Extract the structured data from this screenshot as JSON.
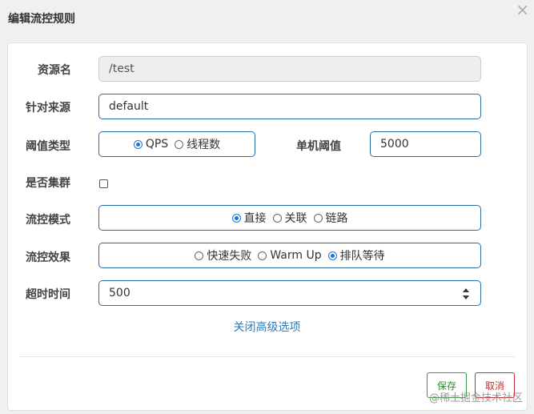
{
  "dialog": {
    "title": "编辑流控规则",
    "close_label": "×"
  },
  "form": {
    "resource": {
      "label": "资源名",
      "value": "/test"
    },
    "limit_app": {
      "label": "针对来源",
      "value": "default"
    },
    "threshold_type": {
      "label": "阈值类型",
      "options": [
        "QPS",
        "线程数"
      ],
      "selected": "QPS"
    },
    "single_threshold": {
      "label": "单机阈值",
      "value": "5000"
    },
    "cluster": {
      "label": "是否集群",
      "checked": false
    },
    "strategy": {
      "label": "流控模式",
      "options": [
        "直接",
        "关联",
        "链路"
      ],
      "selected": "直接"
    },
    "control_behavior": {
      "label": "流控效果",
      "options": [
        "快速失败",
        "Warm Up",
        "排队等待"
      ],
      "selected": "排队等待"
    },
    "timeout": {
      "label": "超时时间",
      "value": "500"
    }
  },
  "advanced_link": "关闭高级选项",
  "buttons": {
    "save": "保存",
    "cancel": "取消"
  },
  "watermark": "@稀土掘金技术社区",
  "colors": {
    "accent": "#1976d2",
    "field_border": "#2a6ea6",
    "save": "#3c9d3c",
    "cancel": "#c9302c",
    "link": "#337ab7"
  }
}
